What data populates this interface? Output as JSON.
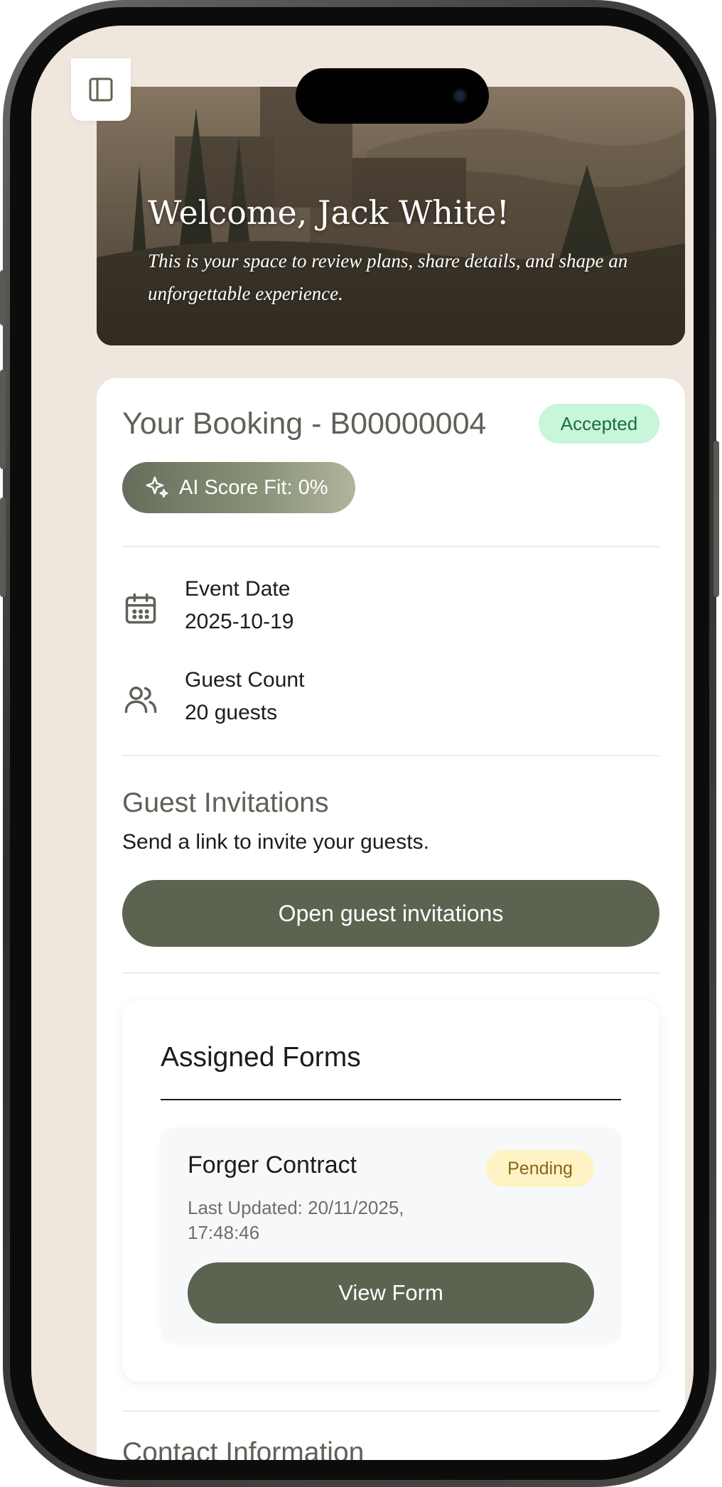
{
  "hero": {
    "title": "Welcome, Jack White!",
    "subtitle": "This is your space to review plans, share details, and shape an unforgettable experience."
  },
  "booking": {
    "title": "Your Booking - B00000004",
    "status": "Accepted",
    "ai_score": "AI Score Fit: 0%",
    "event_date_label": "Event Date",
    "event_date_value": "2025-10-19",
    "guest_count_label": "Guest Count",
    "guest_count_value": "20 guests"
  },
  "invitations": {
    "title": "Guest Invitations",
    "description": "Send a link to invite your guests.",
    "button_label": "Open guest invitations"
  },
  "forms": {
    "title": "Assigned Forms",
    "items": [
      {
        "name": "Forger Contract",
        "status": "Pending",
        "last_updated": "Last Updated: 20/11/2025, 17:48:46",
        "button_label": "View Form"
      }
    ]
  },
  "contact": {
    "title": "Contact Information"
  },
  "icons": {
    "sidebar": "sidebar-toggle-icon",
    "sparkle": "sparkle-icon",
    "calendar": "calendar-icon",
    "users": "users-icon"
  },
  "colors": {
    "primary": "#5c6351",
    "page_background": "#efe7dd",
    "accepted_bg": "#c8f6da",
    "pending_bg": "#fdf3c4"
  }
}
